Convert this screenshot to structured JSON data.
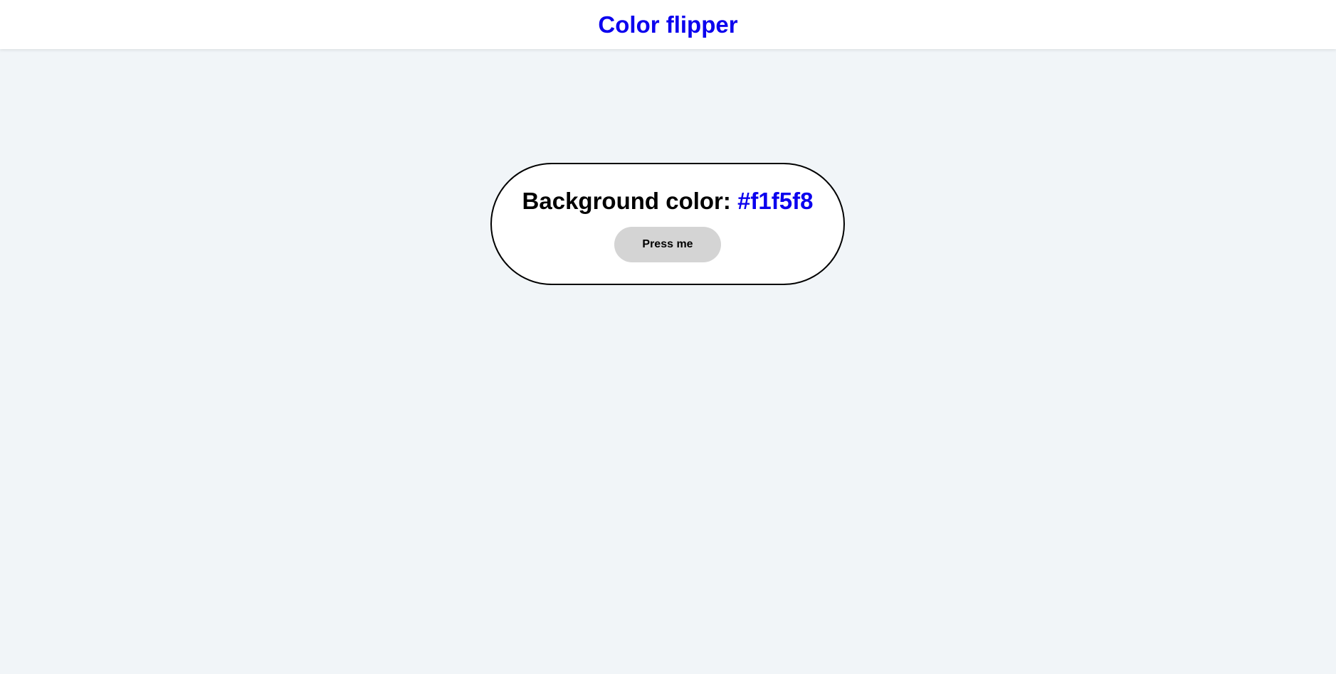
{
  "navbar": {
    "title": "Color flipper"
  },
  "card": {
    "label": "Background color: ",
    "color_value": "#f1f5f8",
    "button_label": "Press me"
  },
  "colors": {
    "page_background": "#f1f5f8",
    "accent": "#0b00ee",
    "button_background": "#d4d4d4",
    "card_background": "#ffffff",
    "card_border": "#000000"
  }
}
